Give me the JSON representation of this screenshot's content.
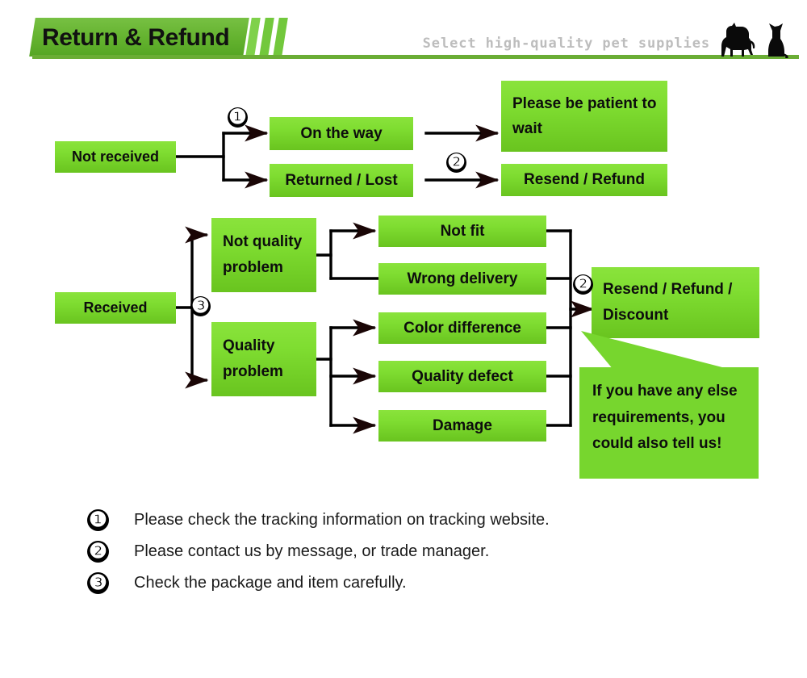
{
  "header": {
    "title": "Return & Refund",
    "tagline": "Select high-quality pet supplies",
    "accent_color": "#6aad35",
    "banner_color": "#63b22e",
    "tagline_color": "#bdbdbd",
    "icons": [
      "dog-silhouette",
      "cat-silhouette"
    ]
  },
  "flow_top": {
    "boxes": {
      "not_received": "Not received",
      "on_the_way": "On the way",
      "returned_lost": "Returned / Lost",
      "please_be_patient": "Please be patient to wait",
      "resend_refund": "Resend / Refund"
    },
    "markers": {
      "one": "❶",
      "two": "❷"
    }
  },
  "flow_bottom": {
    "boxes": {
      "received": "Received",
      "not_quality_problem": "Not quality problem",
      "quality_problem": "Quality problem",
      "not_fit": "Not fit",
      "wrong_delivery": "Wrong delivery",
      "color_difference": "Color difference",
      "quality_defect": "Quality defect",
      "damage": "Damage",
      "resend_refund_discount": "Resend / Refund / Discount"
    },
    "callout": "If you have any else requirements, you could also tell us!",
    "markers": {
      "two": "❷",
      "three": "❸"
    }
  },
  "notes": [
    {
      "bullet": "❶",
      "text": "Please check the tracking information on tracking website."
    },
    {
      "bullet": "❷",
      "text": "Please contact us by message, or trade manager."
    },
    {
      "bullet": "❸",
      "text": "Check the package and item carefully."
    }
  ],
  "colors": {
    "box_green_top": "#8ae33c",
    "box_green_bottom": "#69c41f",
    "callout_green": "#77d62e",
    "line_black": "#000000"
  }
}
